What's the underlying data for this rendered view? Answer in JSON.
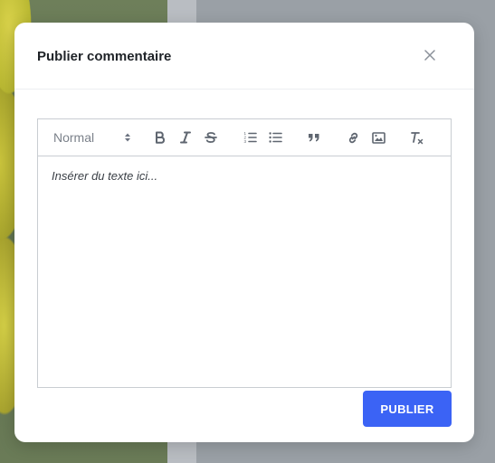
{
  "modal": {
    "title": "Publier commentaire",
    "close_icon": "close-icon"
  },
  "editor": {
    "format_select": {
      "value": "Normal"
    },
    "toolbar_icons": [
      "bold-icon",
      "italic-icon",
      "strike-icon",
      "ordered-list-icon",
      "bullet-list-icon",
      "quote-icon",
      "link-icon",
      "image-icon",
      "clear-format-icon"
    ],
    "placeholder": "Insérer du texte ici..."
  },
  "actions": {
    "publish_label": "PUBLIER"
  },
  "colors": {
    "accent": "#3b63f5",
    "icon": "#6b7280"
  }
}
